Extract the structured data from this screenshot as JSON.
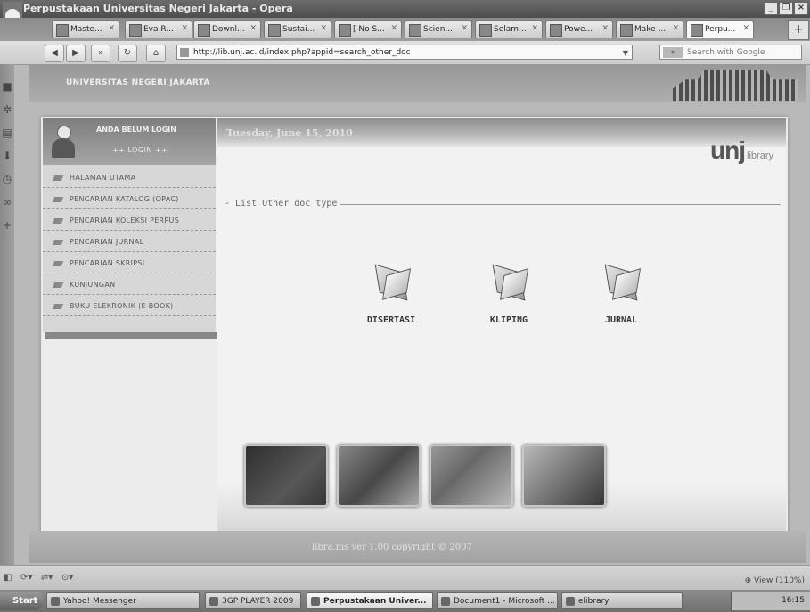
{
  "window": {
    "title": "Perpustakaan Universitas Negeri Jakarta - Opera",
    "controls": [
      "_",
      "❐",
      "×"
    ]
  },
  "tabs": [
    {
      "label": "Maste..."
    },
    {
      "label": "Eva R..."
    },
    {
      "label": "Downl..."
    },
    {
      "label": "Sustai..."
    },
    {
      "label": "[ No S..."
    },
    {
      "label": "Scien..."
    },
    {
      "label": "Selam..."
    },
    {
      "label": "Powe..."
    },
    {
      "label": "Make ..."
    },
    {
      "label": "Perpu...",
      "active": true
    }
  ],
  "address": {
    "url": "http://lib.unj.ac.id/index.php?appid=search_other_doc",
    "search_placeholder": "Search with Google"
  },
  "site": {
    "university": "UNIVERSITAS NEGERI JAKARTA",
    "date": "Tuesday, June 15, 2010",
    "logo_main": "unj",
    "logo_sub": "library",
    "footer": "libra.ms ver 1.00 copyright © 2007"
  },
  "login": {
    "status": "ANDA BELUM LOGIN",
    "link": "++ LOGIN ++"
  },
  "menu": [
    "HALAMAN UTAMA",
    "PENCARIAN KATALOG (OPAC)",
    "PENCARIAN KOLEKSI PERPUS",
    "PENCARIAN JURNAL",
    "PENCARIAN SKRIPSI",
    "KUNJUNGAN",
    "BUKU ELEKRONIK (E-BOOK)"
  ],
  "list_heading": "- List Other_doc_type",
  "doc_types": [
    "DISERTASI",
    "KLIPING",
    "JURNAL"
  ],
  "statusbar": {
    "zoom": "View (110%)"
  },
  "taskbar": {
    "start": "Start",
    "tasks": [
      {
        "label": "Yahoo! Messenger"
      },
      {
        "label": "3GP PLAYER 2009"
      },
      {
        "label": "Perpustakaan Univer...",
        "active": true
      },
      {
        "label": "Document1 - Microsoft ..."
      },
      {
        "label": "elibrary"
      }
    ],
    "clock": "16:15"
  }
}
